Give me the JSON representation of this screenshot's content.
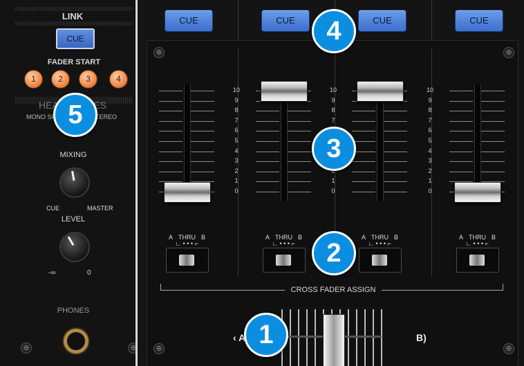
{
  "link": {
    "title": "LINK",
    "cue_label": "CUE"
  },
  "fader_start": {
    "title": "FADER START",
    "buttons": [
      "1",
      "2",
      "3",
      "4"
    ]
  },
  "headphones": {
    "title": "HEADPHONES",
    "mono_split": "MONO SPLIT",
    "stereo": "STEREO"
  },
  "mixing": {
    "title": "MIXING",
    "left": "CUE",
    "right": "MASTER"
  },
  "level": {
    "title": "LEVEL",
    "min": "-∞",
    "max": "0"
  },
  "phones": {
    "label": "PHONES"
  },
  "channels": [
    {
      "cue": "CUE",
      "fader_level": 0
    },
    {
      "cue": "CUE",
      "fader_level": 10
    },
    {
      "cue": "CUE",
      "fader_level": 10
    },
    {
      "cue": "CUE",
      "fader_level": 0
    }
  ],
  "fader_scale": [
    "10",
    "9",
    "8",
    "7",
    "6",
    "5",
    "4",
    "3",
    "2",
    "1",
    "0"
  ],
  "thru": {
    "a": "A",
    "thru": "THRU",
    "b": "B"
  },
  "crossfader_assign": "CROSS FADER ASSIGN",
  "crossfader": {
    "left": "A",
    "right": "B)",
    "position": 0.5
  },
  "markers": [
    "1",
    "2",
    "3",
    "4",
    "5"
  ]
}
